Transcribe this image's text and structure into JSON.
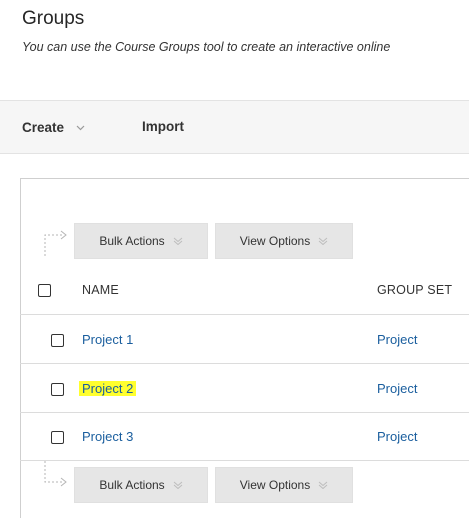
{
  "page": {
    "title": "Groups",
    "description": "You can use the Course Groups tool to create an interactive online"
  },
  "toolbar": {
    "create_label": "Create",
    "import_label": "Import"
  },
  "actions": {
    "bulk_actions_label": "Bulk Actions",
    "view_options_label": "View Options"
  },
  "table": {
    "columns": [
      "NAME",
      "GROUP SET"
    ],
    "rows": [
      {
        "name": "Project 1",
        "group_set": "Project",
        "highlighted": false
      },
      {
        "name": "Project 2",
        "group_set": "Project",
        "highlighted": true
      },
      {
        "name": "Project 3",
        "group_set": "Project",
        "highlighted": false
      }
    ]
  },
  "colors": {
    "link": "#1a5e9e",
    "highlight": "#ffff2e",
    "button_bg": "#e6e6e6"
  }
}
